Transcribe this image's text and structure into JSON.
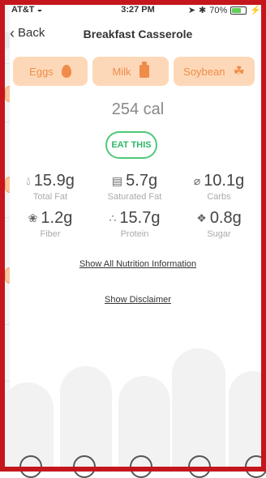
{
  "status_bar": {
    "carrier": "AT&T",
    "time": "3:27 PM",
    "battery_text": "70%"
  },
  "nav": {
    "back_label": "Back",
    "title": "Breakfast Casserole"
  },
  "allergens": [
    {
      "label": "Eggs",
      "icon": "egg-icon"
    },
    {
      "label": "Milk",
      "icon": "milk-carton-icon"
    },
    {
      "label": "Soybean",
      "icon": "soybean-icon"
    }
  ],
  "calories": "254 cal",
  "eat_button": "EAT THIS",
  "nutrients": [
    {
      "value": "15.9g",
      "label": "Total Fat",
      "icon": "fat-drop-icon"
    },
    {
      "value": "5.7g",
      "label": "Saturated Fat",
      "icon": "butter-icon"
    },
    {
      "value": "10.1g",
      "label": "Carbs",
      "icon": "bread-icon"
    },
    {
      "value": "1.2g",
      "label": "Fiber",
      "icon": "wheat-icon"
    },
    {
      "value": "15.7g",
      "label": "Protein",
      "icon": "protein-icon"
    },
    {
      "value": "0.8g",
      "label": "Sugar",
      "icon": "sugar-icon"
    }
  ],
  "links": {
    "nutrition": "Show All Nutrition Information",
    "disclaimer": "Show Disclaimer"
  },
  "colors": {
    "accent_orange": "#f08b4a",
    "chip_bg": "#fdd8b8",
    "eat_green": "#4fc97a",
    "frame_red": "#c4161c"
  }
}
